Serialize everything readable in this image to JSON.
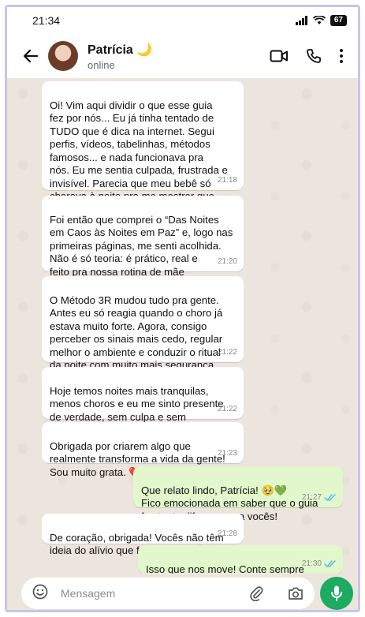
{
  "status_bar": {
    "time": "21:34",
    "battery": "67"
  },
  "header": {
    "contact_name": "Patrícia 🌙",
    "status": "online"
  },
  "icons": {
    "back": "arrow-left-icon",
    "video": "video-call-icon",
    "call": "phone-icon",
    "menu": "more-vert-icon",
    "emoji": "emoji-icon",
    "attach": "paperclip-icon",
    "camera": "camera-icon",
    "mic": "microphone-icon"
  },
  "colors": {
    "incoming": "#ffffff",
    "outgoing": "#e2f7cb",
    "accent": "#1daa61",
    "read_ticks": "#53bdeb"
  },
  "messages": [
    {
      "text": "Oi! Vim aqui dividir o que esse guia\nfez por nós... Eu já tinha tentado de\nTUDO que é dica na internet. Segui\nperfis, vídeos, tabelinhas, métodos\nfamosos... e nada funcionava pra\nnós. Eu me sentia culpada, frustrada e\ninvisível. Parecia que meu bebê só\nchorava à noite pra me mostrar que\neu não dava conta. 😔",
      "time": "21:18"
    },
    {
      "text": "Foi então que comprei o “Das Noites\nem Caos às Noites em Paz” e, logo nas\nprimeiras páginas, me senti acolhida.\nNão é só teoria: é prático, real e\nfeito pra nossa rotina de mãe\nexhausta mesmo!",
      "time": "21:20"
    },
    {
      "text": "O Método 3R mudou tudo pra gente.\nAntes eu só reagia quando o choro já\nestava muito forte. Agora, consigo\nperceber os sinais mais cedo, regular\nmelhor o ambiente e conduzir o ritual\nda noite com muito mais segurança.",
      "time": "21:22"
    },
    {
      "text": "Hoje temos noites mais tranquilas,\nmenos choros e eu me sinto presente\nde verdade, sem culpa e sem\nsensação de impotência. 💗",
      "time": "21:22"
    },
    {
      "text": "Obrigada por criarem algo que\nrealmente transforma a vida da gente!\nSou muito grata. ❤️",
      "time": "21:23"
    },
    {
      "text": "Que relato lindo, Patrícia! 🥹💚\nFico emocionada em saber que o guia\nfez tanta diferença pra vocês!",
      "time": "21:27"
    },
    {
      "text": "De coração, obrigada! Vocês não têm\nideia do alívio que foi pra mim. 🙏🏼💗",
      "time": "21:28"
    },
    {
      "text": "Isso que nos move! Conte sempre\ncom a gente. 🌙✨",
      "time": "21:30"
    }
  ],
  "input": {
    "placeholder": "Mensagem"
  }
}
